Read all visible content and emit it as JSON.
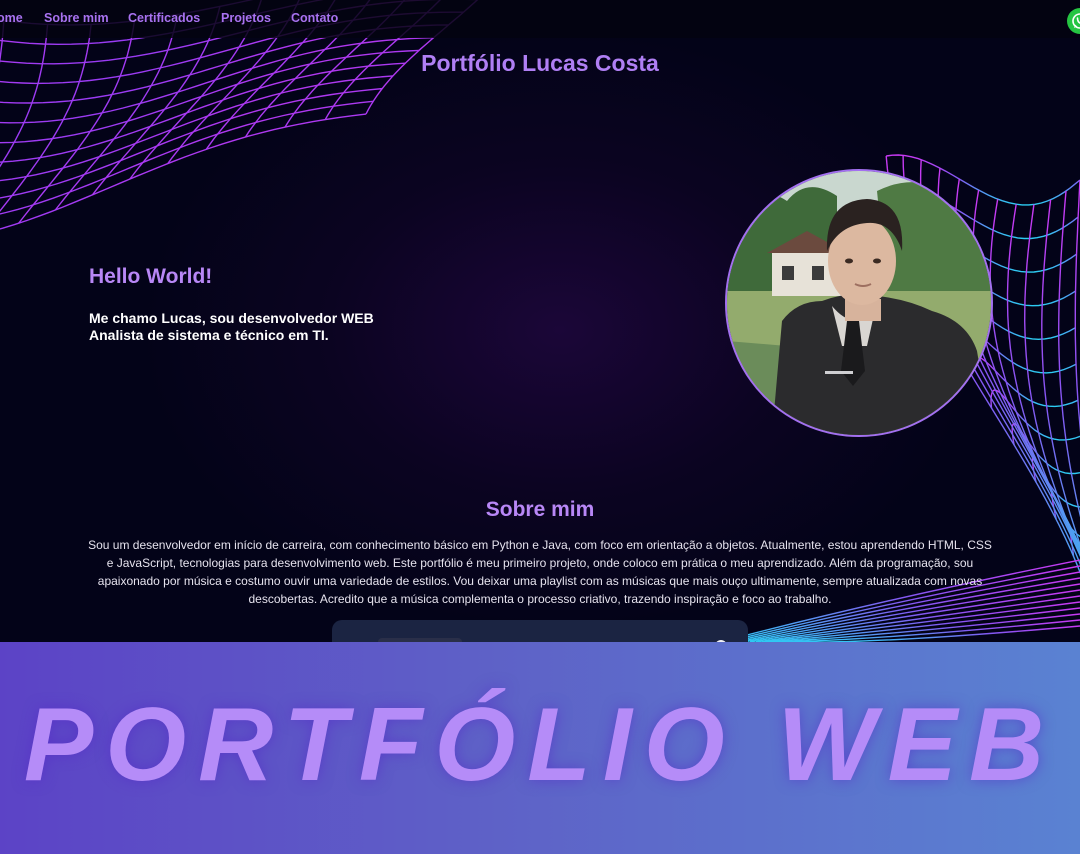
{
  "navbar": {
    "links": [
      {
        "label": "Home"
      },
      {
        "label": "Sobre mim"
      },
      {
        "label": "Certificados"
      },
      {
        "label": "Projetos"
      },
      {
        "label": "Contato"
      }
    ],
    "whatsapp_icon": "whatsapp-icon"
  },
  "header": {
    "title": "Portfólio Lucas Costa"
  },
  "hero": {
    "greeting": "Hello World!",
    "intro_line1": "Me chamo Lucas, sou desenvolvedor WEB",
    "intro_line2": "Analista de sistema e técnico em TI."
  },
  "about": {
    "title": "Sobre mim",
    "text": "Sou um desenvolvedor em início de carreira, com conhecimento básico em Python e Java, com foco em orientação a objetos. Atualmente, estou aprendendo HTML, CSS e JavaScript, tecnologias para desenvolvimento web. Este portfólio é meu primeiro projeto, onde coloco em prática o meu aprendizado. Além da programação, sou apaixonado por música e costumo ouvir uma variedade de estilos. Vou deixar uma playlist com as músicas que mais ouço ultimamente, sempre atualizada com novas descobertas. Acredito que a música complementa o processo criativo, trazendo inspiração e foco ao trabalho."
  },
  "banner": {
    "text": "PORTFÓLIO WEB"
  },
  "colors": {
    "accent": "#b07ff4",
    "nav_link": "#a872f0",
    "banner_start": "#5c43c6",
    "banner_end": "#5a82d2",
    "whatsapp": "#25c542"
  }
}
